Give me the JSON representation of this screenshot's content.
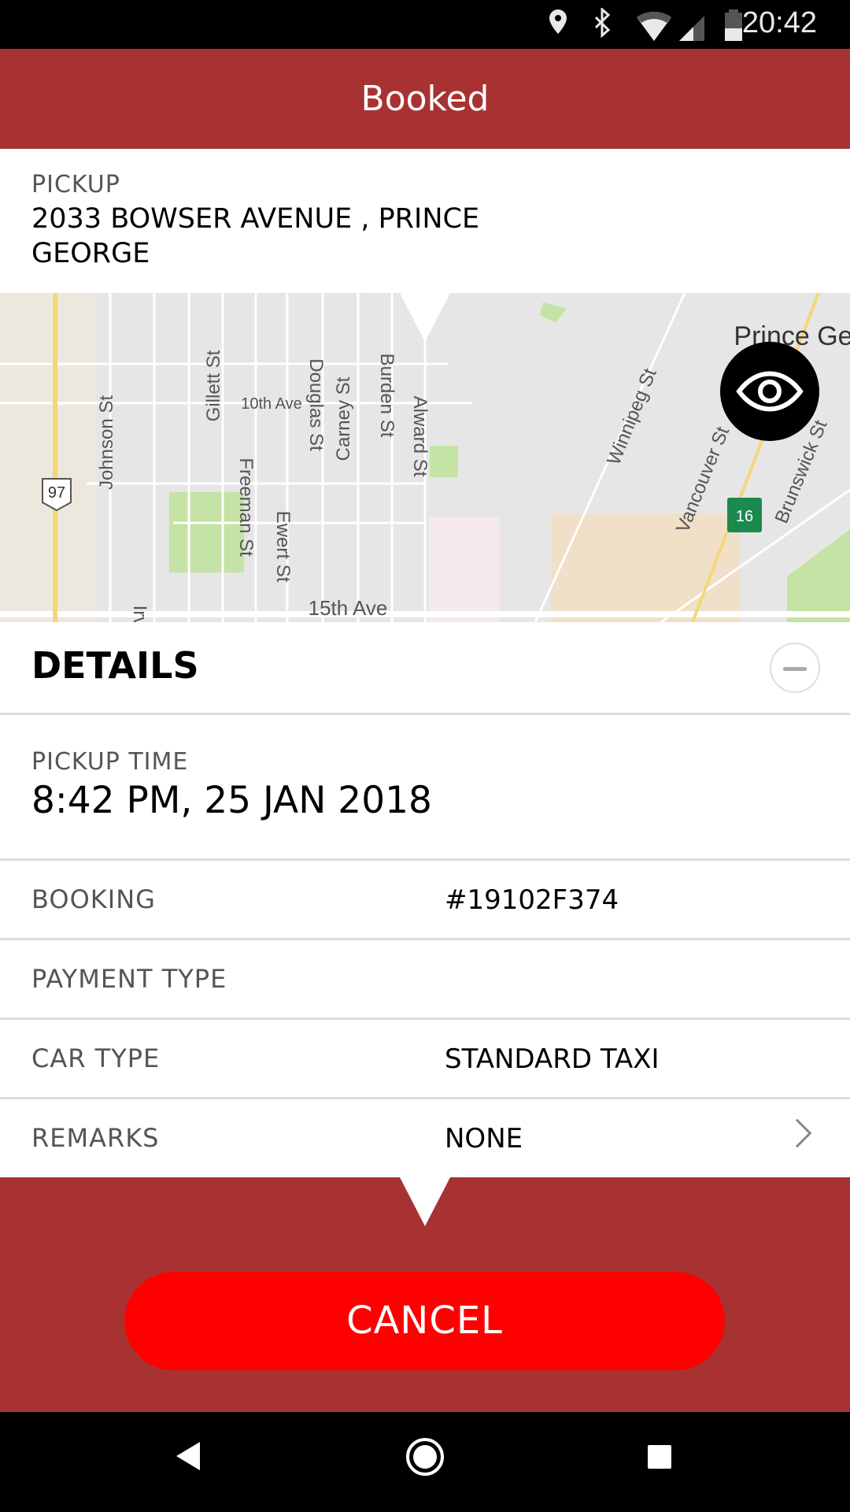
{
  "status_bar": {
    "time": "20:42",
    "icons": [
      "location-icon",
      "bluetooth-icon",
      "wifi-icon",
      "signal-icon",
      "battery-icon"
    ]
  },
  "header": {
    "title": "Booked"
  },
  "pickup": {
    "label": "PICKUP",
    "address": "2033 BOWSER AVENUE , PRINCE GEORGE"
  },
  "map": {
    "labels": [
      "Prince Ge",
      "Johnson St",
      "Gillett St",
      "10th Ave",
      "Douglas St",
      "Carney St",
      "Burden St",
      "Alward St",
      "Freeman St",
      "Ewert St",
      "15th Ave",
      "Winnipeg St",
      "Vancouver St",
      "Brunswick St",
      "Irv",
      "97",
      "16"
    ],
    "toggle_icon": "eye-icon"
  },
  "details": {
    "title": "DETAILS",
    "pickup_time": {
      "label": "PICKUP TIME",
      "value": "8:42 PM, 25 JAN 2018"
    },
    "rows": [
      {
        "label": "BOOKING",
        "value": "#19102F374"
      },
      {
        "label": "PAYMENT TYPE",
        "value": ""
      },
      {
        "label": "CAR TYPE",
        "value": "STANDARD TAXI"
      },
      {
        "label": "REMARKS",
        "value": "NONE"
      }
    ]
  },
  "actions": {
    "cancel": "CANCEL"
  },
  "colors": {
    "header": "#a83232",
    "cancel": "#fe0000"
  }
}
